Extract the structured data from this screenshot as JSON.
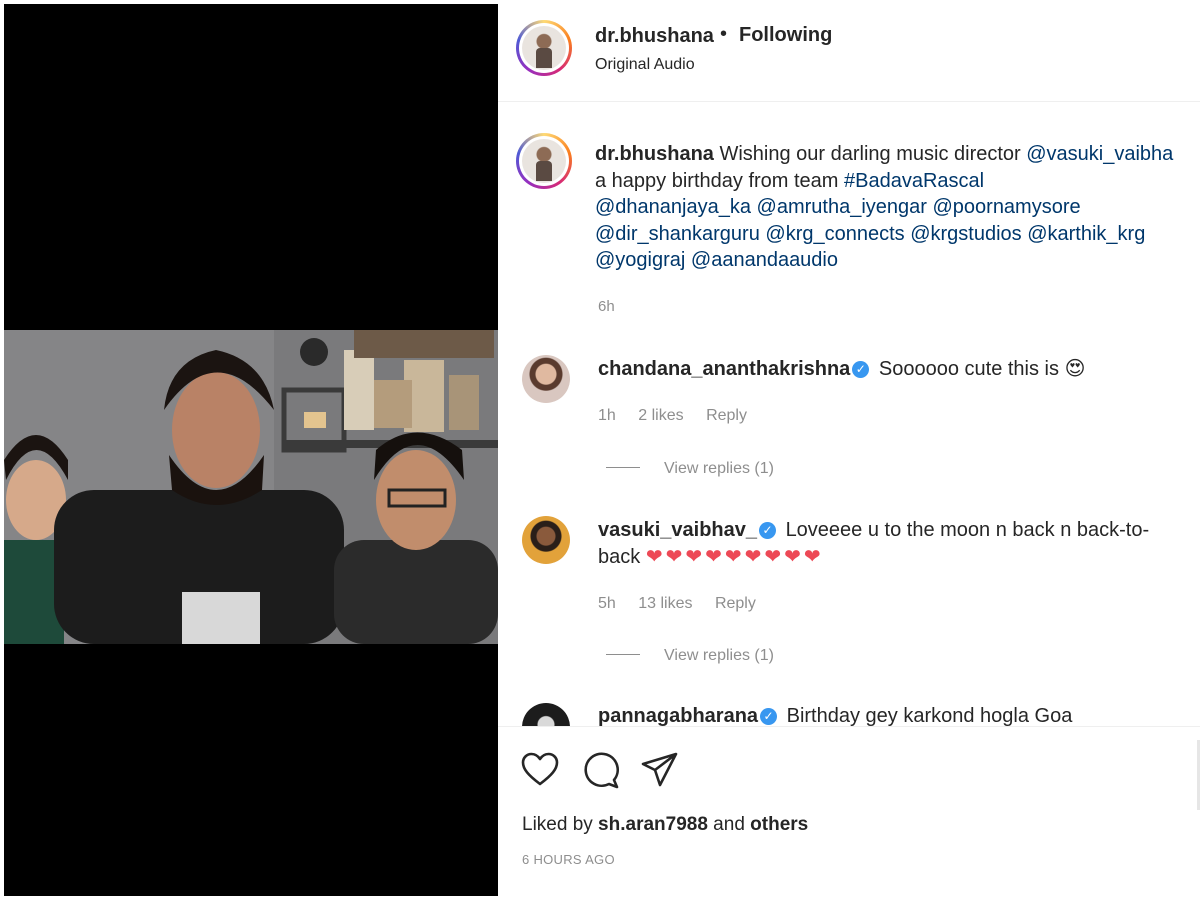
{
  "post": {
    "username": "dr.bhushana",
    "follow_status": "Following",
    "separator": "•",
    "audio": "Original Audio"
  },
  "caption": {
    "username": "dr.bhushana",
    "text_1": "Wishing our darling music director ",
    "mention_1": "@vasuki_vaibha",
    "text_2": "a happy birthday from team ",
    "hashtag": "#BadavaRascal",
    "line_3": "@dhananjaya_ka @amrutha_iyengar @poornamysore",
    "line_4": "@dir_shankarguru @krg_connects @krgstudios @karthik_krg",
    "line_5": "@yogigraj @aanandaaudio",
    "time": "6h"
  },
  "comments": [
    {
      "username": "chandana_ananthakrishna",
      "verified": true,
      "text": "Soooooo cute this is",
      "emoji": "😍",
      "time": "1h",
      "likes": "2 likes",
      "reply": "Reply",
      "view_replies": "View replies (1)"
    },
    {
      "username": "vasuki_vaibhav_",
      "verified": true,
      "text_1": "Loveeee u to the moon n back n back-to-",
      "text_2": "back",
      "hearts": "❤❤❤❤❤❤❤❤❤",
      "time": "5h",
      "likes": "13 likes",
      "reply": "Reply",
      "view_replies": "View replies (1)"
    },
    {
      "username": "pannagabharana",
      "verified": true,
      "text": "Birthday gey karkond hogla Goa"
    }
  ],
  "footer": {
    "liked_prefix": "Liked by ",
    "liked_user": "sh.aran7988",
    "liked_and": " and ",
    "liked_others": "others",
    "time_ago": "6 HOURS AGO"
  },
  "icons": {
    "like": "heart-icon",
    "comment": "comment-icon",
    "share": "share-icon",
    "verified": "verified-badge-icon"
  },
  "colors": {
    "link": "#00376b",
    "verified": "#3897f0",
    "heart": "#ed4956",
    "muted": "#8e8e8e"
  }
}
